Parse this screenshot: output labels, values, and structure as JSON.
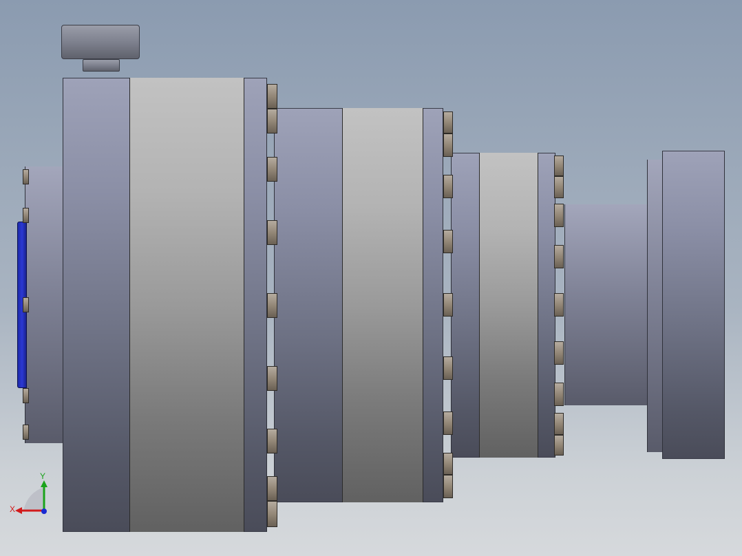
{
  "viewport": {
    "background_top": "#8b9bb0",
    "background_bottom": "#d6d9dc",
    "model_colors": {
      "housing": "#8b8fa6",
      "band": "#b3b3b3",
      "bolt": "#938777",
      "seal": "#2b38d4"
    }
  },
  "triad": {
    "x_label": "X",
    "y_label": "Y",
    "x_color": "#d21b1b",
    "y_color": "#1aa31a",
    "z_color": "#1a2ad2"
  }
}
